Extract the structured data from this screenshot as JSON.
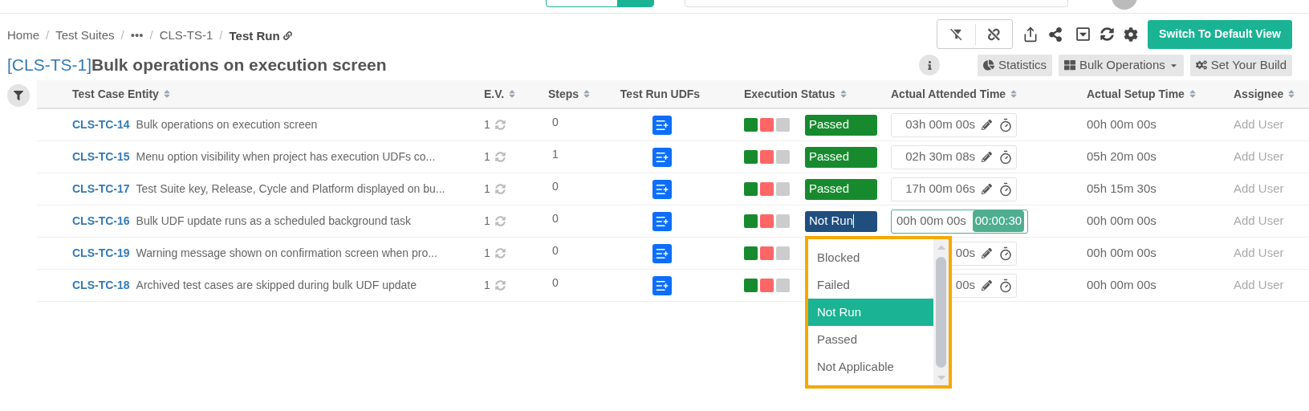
{
  "breadcrumb": [
    {
      "label": "Home",
      "kind": "link",
      "current": false
    },
    {
      "label": "/",
      "kind": "separator"
    },
    {
      "label": "Test Suites",
      "kind": "link",
      "current": false
    },
    {
      "label": "/",
      "kind": "separator"
    },
    {
      "label": "•••",
      "kind": "link",
      "current": false
    },
    {
      "label": "/",
      "kind": "separator"
    },
    {
      "label": "CLS-TS-1",
      "kind": "link",
      "current": false
    },
    {
      "label": "/",
      "kind": "separator"
    },
    {
      "label": "Test Run",
      "kind": "link",
      "current": true
    }
  ],
  "toolbar": {
    "primary_button": "Switch To Default View"
  },
  "title": {
    "key": "[CLS-TS-1]",
    "name": "Bulk operations on execution screen"
  },
  "actions": [
    {
      "label": "Statistics",
      "kind": "stats"
    },
    {
      "label": "Bulk Operations",
      "kind": "bulk"
    },
    {
      "label": "Set Your Build",
      "kind": "build"
    }
  ],
  "table": {
    "columns": [
      "Test Case Entity",
      "E.V.",
      "Steps",
      "Test Run UDFs",
      "Execution Status",
      "Actual Attended Time",
      "Actual Setup Time",
      "Assignee"
    ],
    "rows": [
      {
        "key": "CLS-TC-14",
        "name": "Bulk operations on execution screen",
        "ev": "1",
        "steps": "0",
        "status": {
          "label": "Passed",
          "color": "#178a2e",
          "editing": false
        },
        "attended": "03h 00m 00s",
        "running": false,
        "setup": "00h 00m 00s",
        "assignee": "Add User"
      },
      {
        "key": "CLS-TC-15",
        "name": "Menu option visibility when project has execution UDFs co...",
        "ev": "1",
        "steps": "1",
        "status": {
          "label": "Passed",
          "color": "#178a2e",
          "editing": false
        },
        "attended": "02h 30m 08s",
        "running": false,
        "setup": "05h 20m 00s",
        "assignee": "Add User"
      },
      {
        "key": "CLS-TC-17",
        "name": "Test Suite key, Release, Cycle and Platform displayed on bu...",
        "ev": "1",
        "steps": "0",
        "status": {
          "label": "Passed",
          "color": "#178a2e",
          "editing": false
        },
        "attended": "17h 00m 06s",
        "running": false,
        "setup": "05h 15m 30s",
        "assignee": "Add User"
      },
      {
        "key": "CLS-TC-16",
        "name": "Bulk UDF update runs as a scheduled background task",
        "ev": "1",
        "steps": "0",
        "status": {
          "label": "Not Run",
          "color": "#1f4e7f",
          "editing": true
        },
        "attended": "00h 00m 00s",
        "running": true,
        "timer": "00:00:30",
        "setup": "00h 00m 00s",
        "assignee": "Add User"
      },
      {
        "key": "CLS-TC-19",
        "name": "Warning message shown on confirmation screen when pro...",
        "ev": "1",
        "steps": "0",
        "attended": "00s",
        "running": false,
        "setup": "00h 00m 00s",
        "assignee": "Add User"
      },
      {
        "key": "CLS-TC-18",
        "name": "Archived test cases are skipped during bulk UDF update",
        "ev": "1",
        "steps": "0",
        "attended": "00s",
        "running": false,
        "setup": "00h 00m 00s",
        "assignee": "Add User"
      }
    ]
  },
  "status_dropdown": {
    "options": [
      {
        "label": "Blocked",
        "selected": false
      },
      {
        "label": "Failed",
        "selected": false
      },
      {
        "label": "Not Run",
        "selected": true
      },
      {
        "label": "Passed",
        "selected": false
      },
      {
        "label": "Not Applicable",
        "selected": false
      }
    ]
  }
}
